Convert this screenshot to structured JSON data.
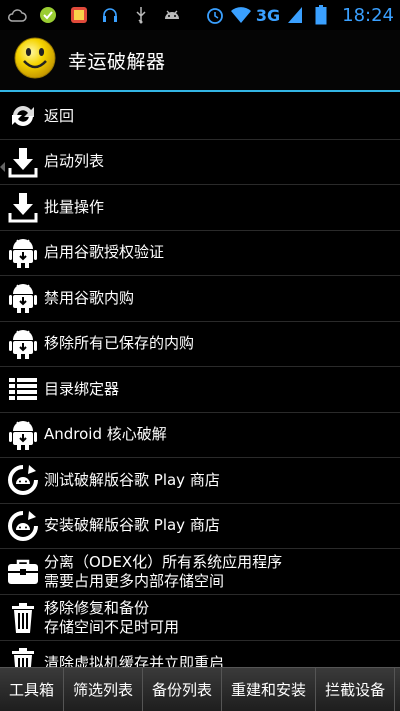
{
  "status_bar": {
    "network": "3G",
    "time": "18:24"
  },
  "header": {
    "title": "幸运破解器"
  },
  "menu": {
    "items": [
      {
        "label": "返回"
      },
      {
        "label": "启动列表"
      },
      {
        "label": "批量操作"
      },
      {
        "label": "启用谷歌授权验证"
      },
      {
        "label": "禁用谷歌内购"
      },
      {
        "label": "移除所有已保存的内购"
      },
      {
        "label": "目录绑定器"
      },
      {
        "label": "Android 核心破解"
      },
      {
        "label": "测试破解版谷歌 Play 商店"
      },
      {
        "label": "安装破解版谷歌 Play 商店"
      },
      {
        "label": "分离（ODEX化）所有系统应用程序",
        "sub": "需要占用更多内部存储空间"
      },
      {
        "label": "移除修复和备份",
        "sub": "存储空间不足时可用"
      },
      {
        "label": "清除虚拟机缓存并立即重启"
      }
    ]
  },
  "bottom_tabs": [
    {
      "label": "工具箱"
    },
    {
      "label": "筛选列表"
    },
    {
      "label": "备份列表"
    },
    {
      "label": "重建和安装"
    },
    {
      "label": "拦截设备"
    }
  ]
}
